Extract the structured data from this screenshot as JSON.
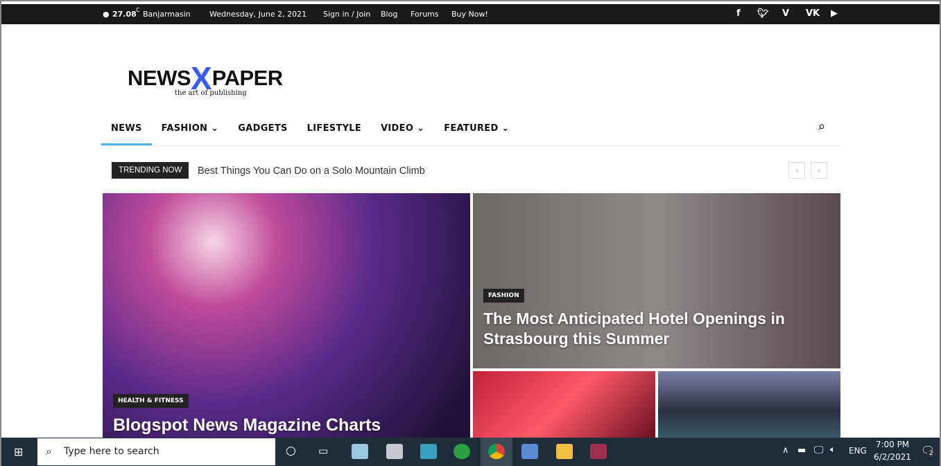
{
  "topbar": {
    "temp": "27.08",
    "unit": "C",
    "city": "Banjarmasin",
    "date": "Wednesday, June 2, 2021",
    "links": [
      "Sign in / Join",
      "Blog",
      "Forums",
      "Buy Now!"
    ],
    "social": [
      "facebook-icon",
      "twitter-icon",
      "vimeo-icon",
      "vk-icon",
      "youtube-icon"
    ]
  },
  "logo": {
    "left": "NEWS",
    "mid": "X",
    "right": "PAPER",
    "tagline": "the art of publishing",
    "accent": "#3a5bf0"
  },
  "nav": {
    "items": [
      "NEWS",
      "FASHION",
      "GADGETS",
      "LIFESTYLE",
      "VIDEO",
      "FEATURED"
    ]
  },
  "trending": {
    "label": "TRENDING NOW",
    "text": "Best Things You Can Do on a Solo Mountain Climb"
  },
  "cards": [
    {
      "category": "HEALTH & FITNESS",
      "title": "Blogspot News Magazine Charts"
    },
    {
      "category": "FASHION",
      "title": "The Most Anticipated Hotel Openings in Strasbourg this Summer"
    }
  ],
  "taskbar": {
    "search_placeholder": "Type here to search",
    "lang": "ENG",
    "time": "7:00 PM",
    "date": "6/2/2021",
    "notifications": "2"
  }
}
